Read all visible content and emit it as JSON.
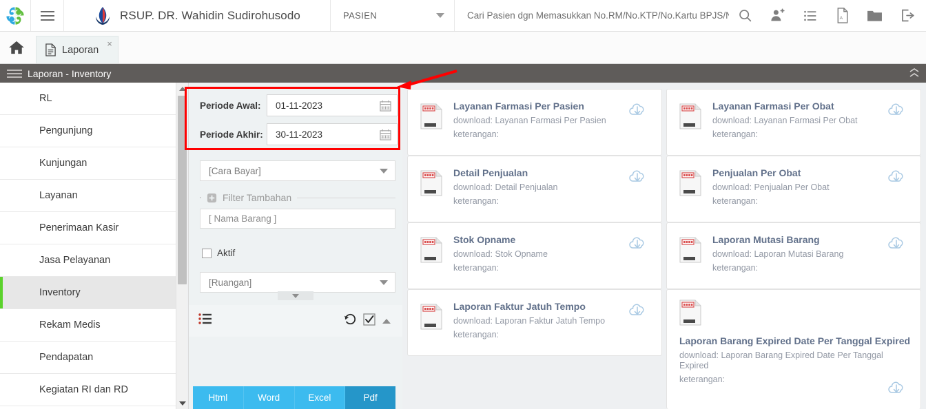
{
  "header": {
    "logo_icon": "pinwheel-logo",
    "menu_icon": "hamburger-icon",
    "brand_icon": "hospital-lotus-icon",
    "brand_title": "RSUP. DR. Wahidin Sudirohusodo",
    "context_select": "PASIEN",
    "search_placeholder": "Cari Pasien dgn Memasukkan No.RM/No.KTP/No.Kartu BPJS/Nama",
    "search_value": "",
    "icons": [
      {
        "name": "search-icon",
        "glyph": "search"
      },
      {
        "name": "add-user-icon",
        "glyph": "user-plus"
      },
      {
        "name": "list-icon",
        "glyph": "list"
      },
      {
        "name": "pdf-icon",
        "glyph": "pdf"
      },
      {
        "name": "folder-icon",
        "glyph": "folder"
      },
      {
        "name": "logout-icon",
        "glyph": "logout"
      }
    ]
  },
  "tabs": {
    "home_icon": "home-icon",
    "items": [
      {
        "label": "Laporan",
        "icon": "document-icon",
        "close": "×",
        "active": true
      }
    ]
  },
  "breadcrumb": {
    "menu_icon": "hamburger-icon",
    "title": "Laporan - Inventory",
    "collapse_icon": "collapse-icon"
  },
  "sidebar": {
    "items": [
      {
        "label": "RL",
        "active": false
      },
      {
        "label": "Pengunjung",
        "active": false
      },
      {
        "label": "Kunjungan",
        "active": false
      },
      {
        "label": "Layanan",
        "active": false
      },
      {
        "label": "Penerimaan Kasir",
        "active": false
      },
      {
        "label": "Jasa Pelayanan",
        "active": false
      },
      {
        "label": "Inventory",
        "active": true
      },
      {
        "label": "Rekam Medis",
        "active": false
      },
      {
        "label": "Pendapatan",
        "active": false
      },
      {
        "label": "Kegiatan RI dan RD",
        "active": false
      }
    ],
    "active_marker_color": "#5bd22c"
  },
  "filter_panel": {
    "periode_awal_label": "Periode Awal:",
    "periode_awal_value": "01-11-2023",
    "periode_akhir_label": "Periode Akhir:",
    "periode_akhir_value": "30-11-2023",
    "calendar_icon": "calendar-icon",
    "cara_bayar_value": "[Cara Bayar]",
    "filter_tambahan_label": "Filter Tambahan",
    "filter_tambahan_icon": "plus-circle-icon",
    "nama_barang_placeholder": "[ Nama Barang ]",
    "nama_barang_value": "",
    "aktif_label": "Aktif",
    "aktif_checked": false,
    "ruangan_value": "[Ruangan]",
    "toolbar": {
      "list_icon": "list-bullets-icon",
      "reset_icon": "history-reset-icon",
      "check_icon": "checkbox-check-icon",
      "collapse_icon": "chevron-up-icon"
    },
    "export_buttons": [
      {
        "label": "Html",
        "active": false
      },
      {
        "label": "Word",
        "active": false
      },
      {
        "label": "Excel",
        "active": false
      },
      {
        "label": "Pdf",
        "active": true
      }
    ]
  },
  "reports": {
    "download_prefix": "download: ",
    "note_label": "keterangan:",
    "cloud_icon": "cloud-download-icon",
    "file_icon": "report-file-icon",
    "cards": [
      {
        "title": "Layanan Farmasi Per Pasien",
        "download": "download: Layanan Farmasi Per Pasien",
        "note": "keterangan:"
      },
      {
        "title": "Layanan Farmasi Per Obat",
        "download": "download: Layanan Farmasi Per Obat",
        "note": "keterangan:"
      },
      {
        "title": "Detail Penjualan",
        "download": "download: Detail Penjualan",
        "note": "keterangan:"
      },
      {
        "title": "Penjualan Per Obat",
        "download": "download: Penjualan Per Obat",
        "note": "keterangan:"
      },
      {
        "title": "Stok Opname",
        "download": "download: Stok Opname",
        "note": "keterangan:"
      },
      {
        "title": "Laporan Mutasi Barang",
        "download": "download: Laporan Mutasi Barang",
        "note": "keterangan:"
      },
      {
        "title": "Laporan Faktur Jatuh Tempo",
        "download": "download: Laporan Faktur Jatuh Tempo",
        "note": "keterangan:"
      },
      {
        "title": "Laporan Barang Expired Date Per Tanggal Expired",
        "download": "download: Laporan Barang Expired Date Per Tanggal Expired",
        "note": "keterangan:"
      }
    ]
  },
  "annotation": {
    "box_color": "#ff0000",
    "arrow_color": "#ff0000"
  }
}
